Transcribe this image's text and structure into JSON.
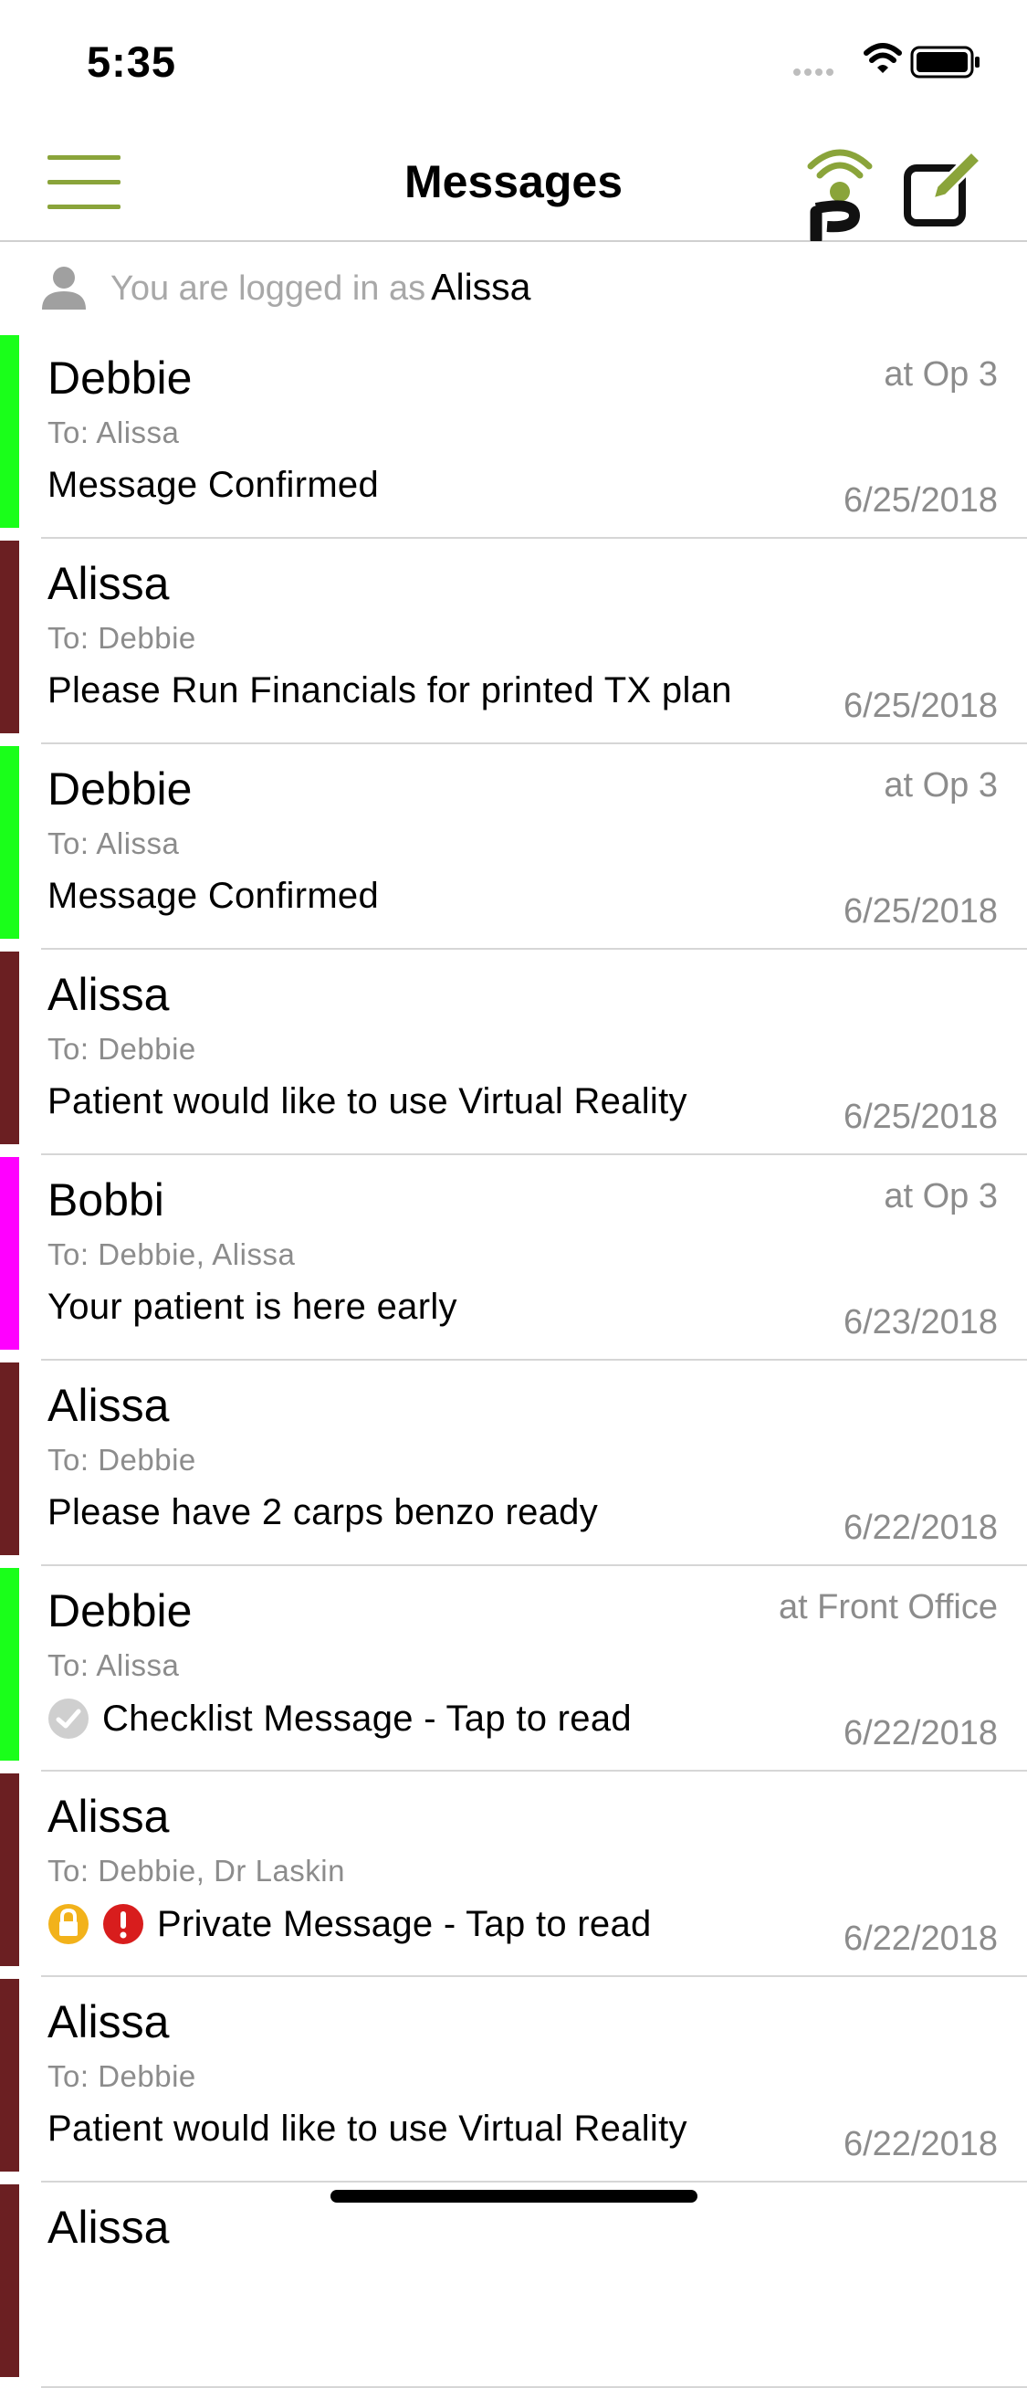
{
  "status": {
    "time": "5:35"
  },
  "nav": {
    "title": "Messages"
  },
  "login": {
    "prefix": "You are logged in as",
    "user": "Alissa"
  },
  "colors": {
    "accent": "#8aa43a",
    "green_bar": "#1aff1a",
    "maroon_bar": "#6b1f22",
    "magenta_bar": "#ff00ff"
  },
  "messages": [
    {
      "sender": "Debbie",
      "to": "To: Alissa",
      "body": "Message Confirmed",
      "location": "at Op 3",
      "date": "6/25/2018",
      "bar_color": "#1aff1a",
      "icons": []
    },
    {
      "sender": "Alissa",
      "to": "To: Debbie",
      "body": "Please Run Financials for printed TX plan",
      "location": "",
      "date": "6/25/2018",
      "bar_color": "#6b1f22",
      "icons": []
    },
    {
      "sender": "Debbie",
      "to": "To: Alissa",
      "body": "Message Confirmed",
      "location": "at Op 3",
      "date": "6/25/2018",
      "bar_color": "#1aff1a",
      "icons": []
    },
    {
      "sender": "Alissa",
      "to": "To: Debbie",
      "body": "Patient would like to use Virtual Reality",
      "location": "",
      "date": "6/25/2018",
      "bar_color": "#6b1f22",
      "icons": []
    },
    {
      "sender": "Bobbi",
      "to": "To: Debbie, Alissa",
      "body": "Your patient is here early",
      "location": "at Op 3",
      "date": "6/23/2018",
      "bar_color": "#ff00ff",
      "icons": []
    },
    {
      "sender": "Alissa",
      "to": "To: Debbie",
      "body": "Please have 2 carps benzo ready",
      "location": "",
      "date": "6/22/2018",
      "bar_color": "#6b1f22",
      "icons": []
    },
    {
      "sender": "Debbie",
      "to": "To: Alissa",
      "body": "Checklist Message - Tap to read",
      "location": "at Front Office",
      "date": "6/22/2018",
      "bar_color": "#1aff1a",
      "icons": [
        "check-circle-icon"
      ]
    },
    {
      "sender": "Alissa",
      "to": "To: Debbie, Dr Laskin",
      "body": "Private Message - Tap to read",
      "location": "",
      "date": "6/22/2018",
      "bar_color": "#6b1f22",
      "icons": [
        "lock-icon",
        "alert-icon"
      ]
    },
    {
      "sender": "Alissa",
      "to": "To: Debbie",
      "body": "Patient would like to use Virtual Reality",
      "location": "",
      "date": "6/22/2018",
      "bar_color": "#6b1f22",
      "icons": []
    },
    {
      "sender": "Alissa",
      "to": "",
      "body": "",
      "location": "",
      "date": "",
      "bar_color": "#6b1f22",
      "icons": []
    }
  ]
}
